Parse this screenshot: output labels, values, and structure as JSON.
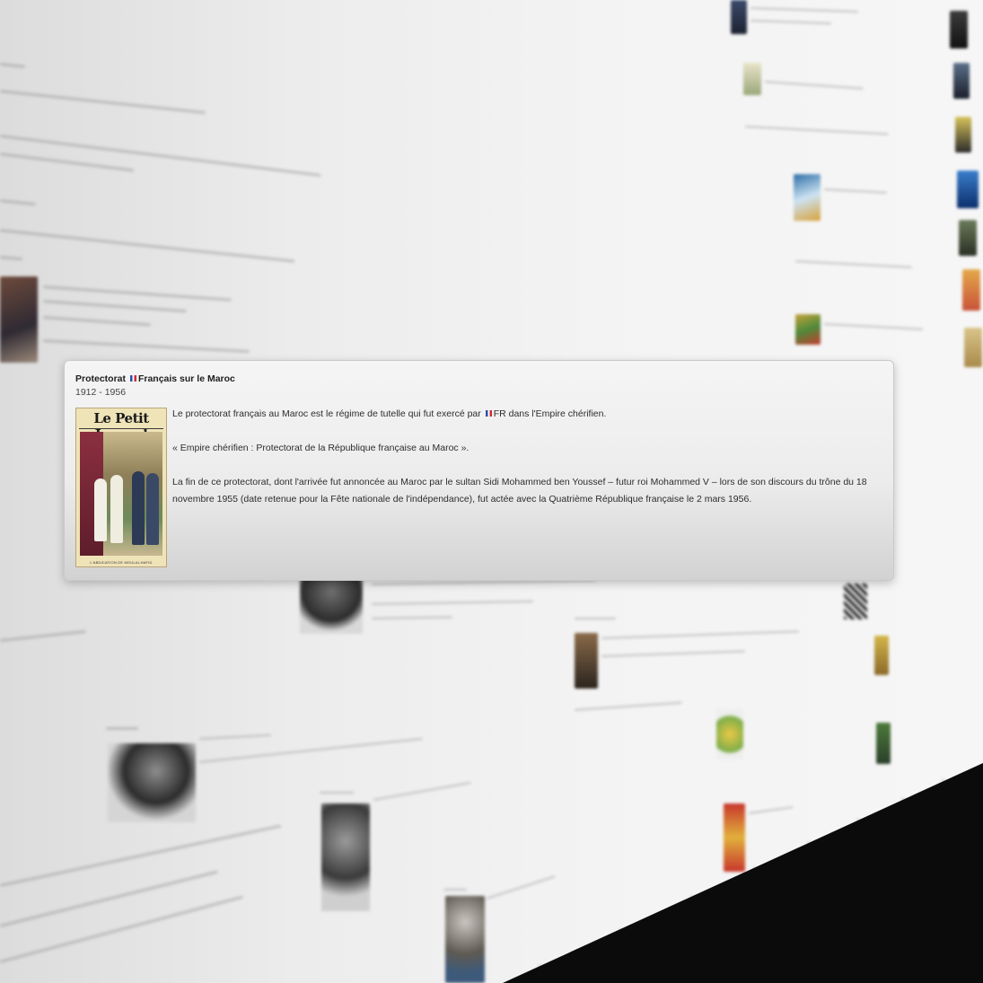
{
  "popup": {
    "title_before_flag": "Protectorat",
    "title_after_flag": "Français sur le Maroc",
    "dates": "1912 - 1956",
    "image": {
      "masthead": "Le Petit Journal",
      "caption": "L'ABDICATION DE MOULAI-HAFID"
    },
    "paragraph_1_before_flag": "Le protectorat français au Maroc est le régime de tutelle qui fut exercé par",
    "paragraph_1_after_flag": "FR dans l'Empire chérifien.",
    "paragraph_2": "« Empire chérifien : Protectorat de la République française au Maroc ».",
    "paragraph_3": "La fin de ce protectorat, dont l'arrivée fut annoncée au Maroc par le sultan Sidi Mohammed ben Youssef – futur roi Mohammed V – lors de son discours du trône du 18 novembre 1955 (date retenue pour la Fête nationale de l'indépendance), fut actée avec la Quatrième République française le 2 mars 1956."
  },
  "colors": {
    "flag_blue": "#2a4fa6",
    "flag_white": "#ffffff",
    "flag_red": "#d22a32"
  },
  "icons": {
    "flag": "france-flag-icon"
  }
}
